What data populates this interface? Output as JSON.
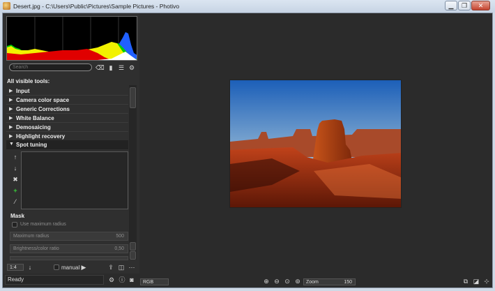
{
  "window": {
    "title": "Desert.jpg - C:\\Users\\Public\\Pictures\\Sample Pictures - Photivo",
    "minimize": "▁",
    "restore": "❐",
    "close": "✕"
  },
  "search": {
    "placeholder": "Search"
  },
  "tools": {
    "header": "All visible tools:",
    "items": [
      {
        "label": "Input",
        "expanded": false
      },
      {
        "label": "Camera color space",
        "expanded": false
      },
      {
        "label": "Generic Corrections",
        "expanded": false
      },
      {
        "label": "White Balance",
        "expanded": false
      },
      {
        "label": "Demosaicing",
        "expanded": false
      },
      {
        "label": "Highlight recovery",
        "expanded": false
      },
      {
        "label": "Spot tuning",
        "expanded": true
      }
    ]
  },
  "spot_tuning": {
    "mask_label": "Mask",
    "use_max_radius": "Use maximum radius",
    "maximum_radius_label": "Maximum radius",
    "maximum_radius_value": "500",
    "brightness_ratio_label": "Brightness/color ratio",
    "brightness_ratio_value": "0,50"
  },
  "bottom_controls": {
    "zoom_ratio": "1:4",
    "manual_label": "manual"
  },
  "status": {
    "ready": "Ready",
    "colorspace": "RGB",
    "zoom_label": "Zoom",
    "zoom_value": "150"
  },
  "colors": {
    "panel_bg": "#2b2b2b",
    "histogram_red": "#e00000",
    "histogram_yellow": "#f2f200",
    "histogram_green": "#00d000",
    "histogram_blue": "#2060ff"
  },
  "icons": [
    "clear-icon",
    "bookmark-icon",
    "menu-icon",
    "gear-icon",
    "arrow-up-icon",
    "arrow-down-icon",
    "delete-icon",
    "add-icon",
    "wand-icon",
    "play-icon",
    "export-icon",
    "tag-icon",
    "more-icon",
    "zoom-in-icon",
    "zoom-out-icon",
    "zoom-fit-icon",
    "zoom-100-icon",
    "fullscreen-icon"
  ]
}
